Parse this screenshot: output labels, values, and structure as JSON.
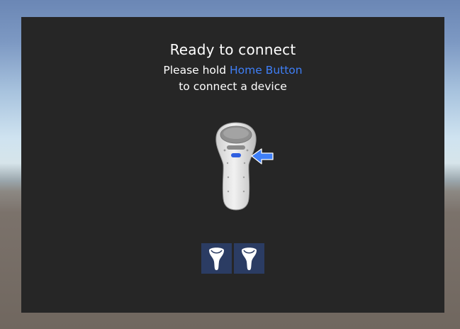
{
  "dialog": {
    "title": "Ready to connect",
    "instruction_prefix": "Please hold ",
    "instruction_highlight": "Home Button",
    "instruction_suffix": "to connect a device"
  },
  "device_slots": [
    {
      "icon": "controller-icon"
    },
    {
      "icon": "controller-icon"
    }
  ],
  "colors": {
    "panel_background": "#262626",
    "accent": "#3f7ff7",
    "slot_background": "#2b3c63",
    "text": "#ffffff"
  }
}
